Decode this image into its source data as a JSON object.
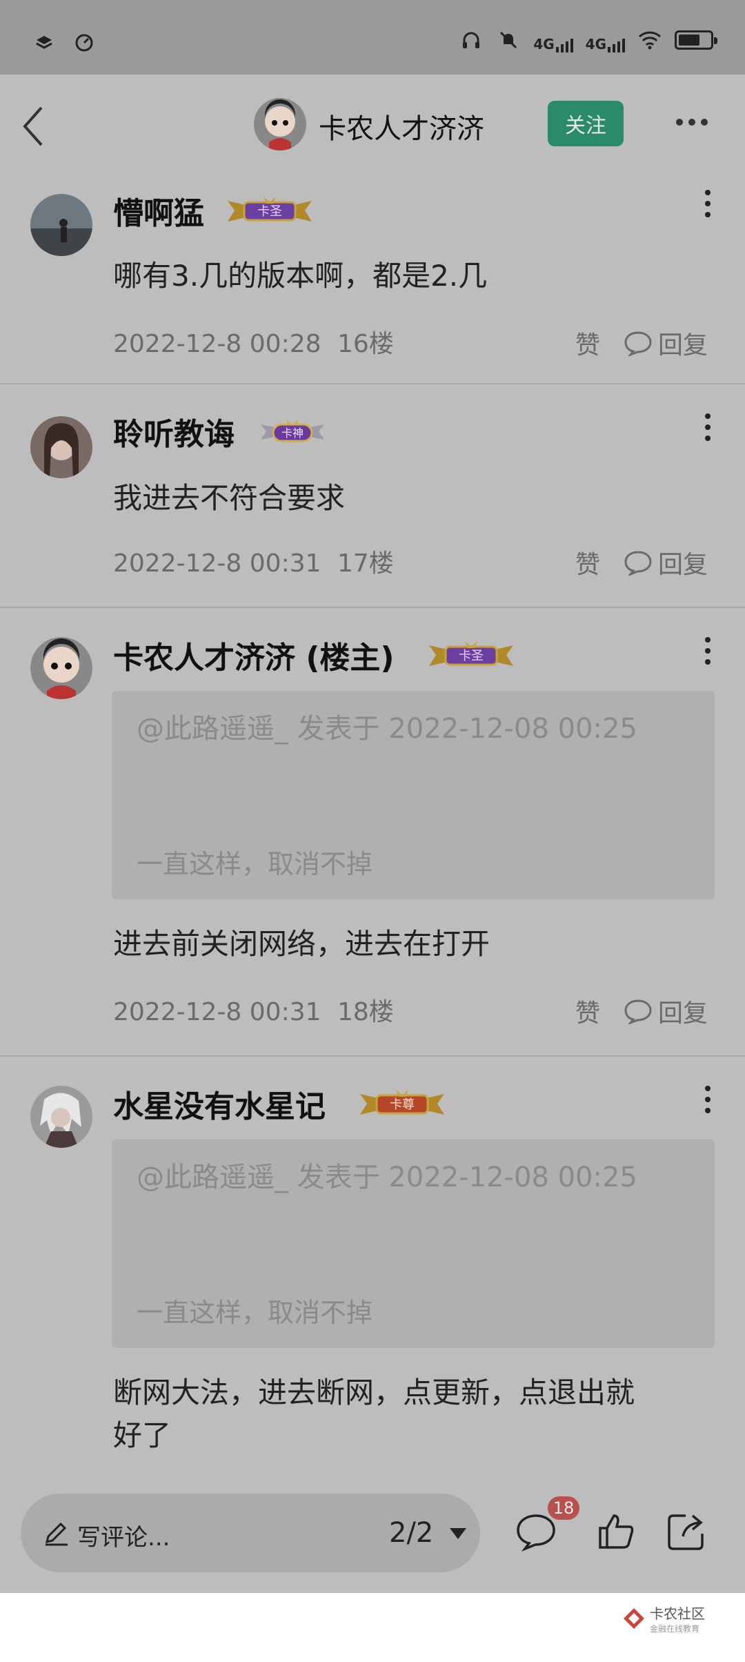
{
  "header": {
    "title": "卡农人才济济",
    "follow_label": "关注"
  },
  "comments": [
    {
      "name": "懵啊猛",
      "badge": "卡圣",
      "text": "哪有3.几的版本啊，都是2.几",
      "time": "2022-12-8 00:28",
      "floor": "16楼",
      "like": "赞",
      "reply": "回复"
    },
    {
      "name": "聆听教诲",
      "badge": "卡神",
      "text": "我进去不符合要求",
      "time": "2022-12-8 00:31",
      "floor": "17楼",
      "like": "赞",
      "reply": "回复"
    },
    {
      "name": "卡农人才济济 (楼主)",
      "badge": "卡圣",
      "quote_head": "@此路遥遥_ 发表于 2022-12-08 00:25",
      "quote_body": "一直这样，取消不掉",
      "text": "进去前关闭网络，进去在打开",
      "time": "2022-12-8 00:31",
      "floor": "18楼",
      "like": "赞",
      "reply": "回复"
    },
    {
      "name": "水星没有水星记",
      "badge": "卡尊",
      "quote_head": "@此路遥遥_ 发表于 2022-12-08 00:25",
      "quote_body": "一直这样，取消不掉",
      "text_line1": "断网大法，进去断网，点更新，点退出就",
      "text_line2": "好了"
    }
  ],
  "bottom": {
    "placeholder": "写评论...",
    "page": "2/2",
    "comment_count": "18"
  },
  "footer": {
    "logo_title": "卡农社区",
    "logo_sub": "金融在线教育"
  },
  "colors": {
    "accent": "#2a8a6c",
    "badge_red": "#b8504e"
  }
}
